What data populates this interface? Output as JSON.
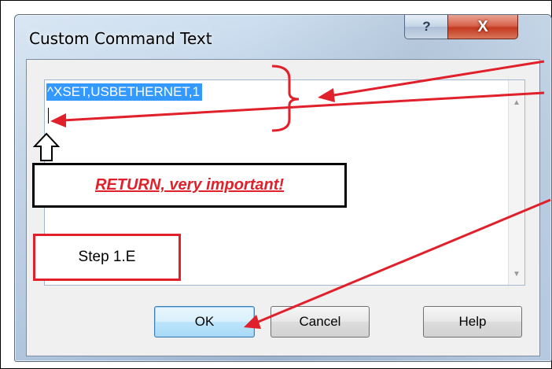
{
  "dialog": {
    "title": "Custom Command Text",
    "help_glyph": "?",
    "close_glyph": "X"
  },
  "editor": {
    "value": "^XSET,USBETHERNET,1",
    "scroll_up_glyph": "▲",
    "scroll_down_glyph": "▼"
  },
  "buttons": {
    "ok": "OK",
    "cancel": "Cancel",
    "help": "Help"
  },
  "annotations": {
    "return_note": "RETURN, very important!",
    "step_label": "Step 1.E",
    "arrow_color": "#e0202a"
  }
}
